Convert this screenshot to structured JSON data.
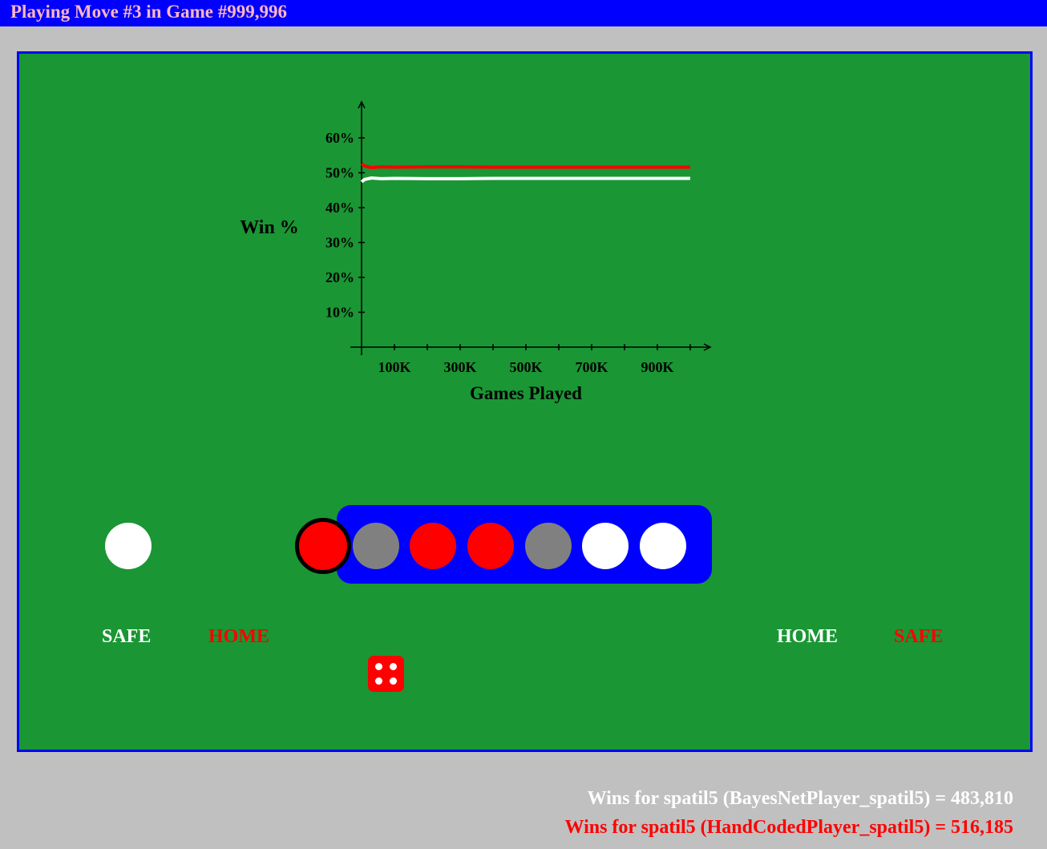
{
  "title": "Playing Move #3 in Game #999,996",
  "colors": {
    "white_player": "#ffffff",
    "red_player": "#ff0000",
    "empty_slot": "#808080",
    "board": "#1a9634",
    "track": "#0000ff",
    "title_bar": "#0000ff",
    "title_text": "#ffb6c1"
  },
  "chart_data": {
    "type": "line",
    "ylabel": "Win %",
    "xlabel": "Games Played",
    "y_ticks": [
      "10%",
      "20%",
      "30%",
      "40%",
      "50%",
      "60%"
    ],
    "x_ticks": [
      "100K",
      "300K",
      "500K",
      "700K",
      "900K"
    ],
    "ylim": [
      0,
      70
    ],
    "xlim": [
      0,
      1050000
    ],
    "grid": false,
    "series": [
      {
        "color": "#ff0000",
        "x": [
          0,
          10000,
          30000,
          60000,
          100000,
          200000,
          300000,
          400000,
          500000,
          600000,
          700000,
          800000,
          900000,
          999996
        ],
        "y": [
          52.6,
          51.9,
          51.5,
          51.7,
          51.6,
          51.7,
          51.7,
          51.6,
          51.6,
          51.6,
          51.6,
          51.6,
          51.6,
          51.6
        ]
      },
      {
        "color": "#ffffff",
        "x": [
          0,
          10000,
          30000,
          60000,
          100000,
          200000,
          300000,
          400000,
          500000,
          600000,
          700000,
          800000,
          900000,
          999996
        ],
        "y": [
          47.4,
          48.1,
          48.5,
          48.3,
          48.4,
          48.3,
          48.3,
          48.4,
          48.4,
          48.4,
          48.4,
          48.4,
          48.4,
          48.4
        ]
      }
    ]
  },
  "board": {
    "white_safe_pieces": 1,
    "slots": [
      {
        "piece": "red",
        "selected": true
      },
      {
        "piece": "empty"
      },
      {
        "piece": "red"
      },
      {
        "piece": "red"
      },
      {
        "piece": "empty"
      },
      {
        "piece": "white"
      },
      {
        "piece": "white"
      }
    ],
    "labels": {
      "left_safe": "SAFE",
      "left_home": "HOME",
      "right_home": "HOME",
      "right_safe": "SAFE"
    },
    "die_value": 4
  },
  "scores": {
    "white": "Wins for spatil5 (BayesNetPlayer_spatil5) = 483,810",
    "red": "Wins for spatil5 (HandCodedPlayer_spatil5) = 516,185"
  }
}
